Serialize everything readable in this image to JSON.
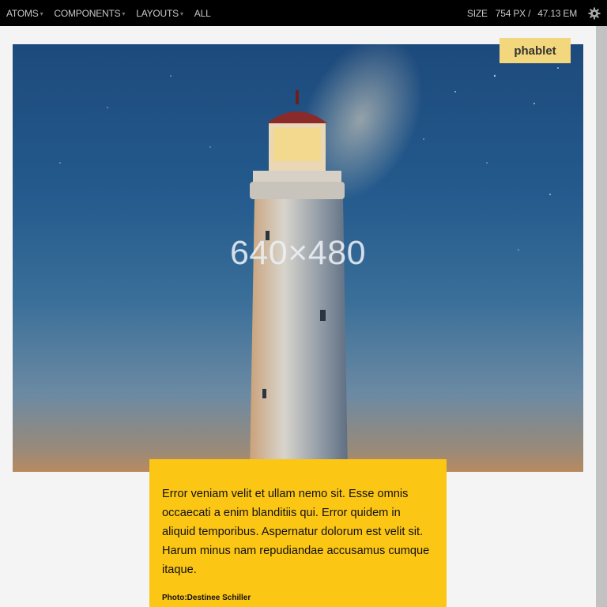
{
  "toolbar": {
    "nav": [
      {
        "label": "ATOMS",
        "has_caret": true
      },
      {
        "label": "COMPONENTS",
        "has_caret": true
      },
      {
        "label": "LAYOUTS",
        "has_caret": true
      },
      {
        "label": "ALL",
        "has_caret": false
      }
    ],
    "size_label": "SIZE",
    "size_px": "754 PX /",
    "size_em": "47.13 EM",
    "settings_icon": "gear-icon",
    "caret_glyph": "▾"
  },
  "badge": {
    "label": "phablet"
  },
  "hero": {
    "placeholder_text": "640×480",
    "colors": {
      "sky_top": "#1d4a7c",
      "horizon": "#b88a60"
    }
  },
  "card": {
    "text": "Error veniam velit et ullam nemo sit. Esse omnis occaecati a enim blanditiis qui. Error quidem in aliquid temporibus. Aspernatur dolorum est velit sit. Harum minus nam repudiandae accusamus cumque itaque.",
    "credit": "Photo:Destinee Schiller",
    "background": "#fcc614"
  }
}
